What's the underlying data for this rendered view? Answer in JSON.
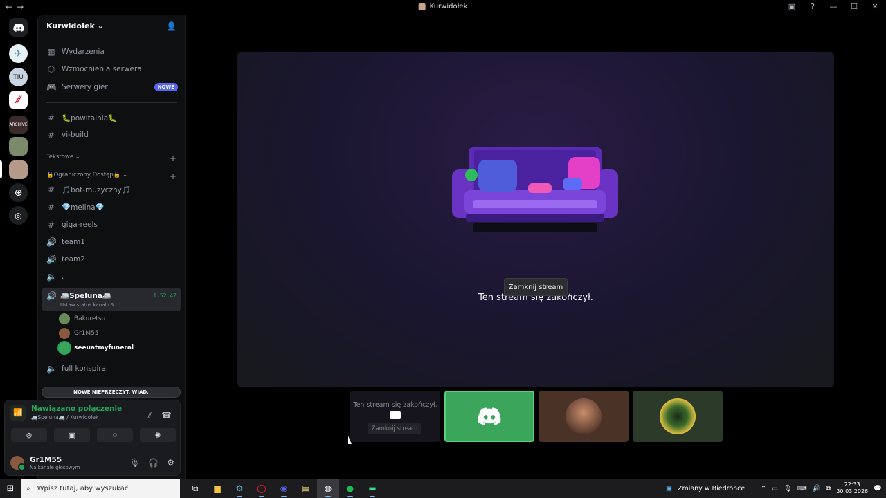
{
  "window": {
    "title": "Kurwidołek"
  },
  "server": {
    "name": "Kurwidołek",
    "menu": [
      {
        "label": "Wydarzenia",
        "icon": "calendar-icon"
      },
      {
        "label": "Wzmocnienia serwera",
        "icon": "boost-icon"
      },
      {
        "label": "Serwery gier",
        "icon": "gamepad-icon",
        "badge": "NOWE"
      }
    ],
    "top_channels": [
      {
        "label": "🐛powitalnia🐛",
        "type": "text"
      },
      {
        "label": "vi-build",
        "type": "text"
      }
    ],
    "categories": {
      "text": "Tekstowe",
      "restricted": "🔒Ograniczony Dostęp🔒"
    },
    "restricted_channels": [
      {
        "label": "🎵bot-muzyczny🎵",
        "type": "text"
      },
      {
        "label": "💎melina💎",
        "type": "text"
      },
      {
        "label": "giga-reels",
        "type": "text"
      },
      {
        "label": "team1",
        "type": "voice"
      },
      {
        "label": "team2",
        "type": "voice"
      },
      {
        "label": ".",
        "type": "voice-locked"
      }
    ],
    "active_voice": {
      "label": "🚐Speluna🚐",
      "status": "Ustaw status kanału",
      "timer": "1:52:42",
      "members": [
        {
          "name": "Bakuretsu",
          "speaking": false
        },
        {
          "name": "Gr1M55",
          "speaking": false
        },
        {
          "name": "seeuatmyfuneral",
          "speaking": true
        }
      ]
    },
    "after_channels": [
      {
        "label": "full konspira",
        "type": "voice-locked"
      }
    ],
    "unread_label": "NOWE NIEPRZECZYT. WIAD."
  },
  "voice_panel": {
    "status": "Nawiązano połączenie",
    "channel": "🚐Speluna🚐 / Kurwidołek"
  },
  "user": {
    "name": "Gr1M55",
    "status": "Na kanale głosowym"
  },
  "stage": {
    "message": "Ten stream się zakończył.",
    "close_label": "Zamknij stream"
  },
  "tiles": {
    "ended_message": "Ten stream się zakończył.",
    "ended_close": "Zamknij stream"
  },
  "taskbar": {
    "search_placeholder": "Wpisz tutaj, aby wyszukać",
    "notification": "Zmiany w Biedronce i...",
    "time": "22:33",
    "date": "30.03.2026"
  },
  "colors": {
    "accent": "#5865f2",
    "online": "#23a55a",
    "discord_tile": "#3ba55c"
  }
}
